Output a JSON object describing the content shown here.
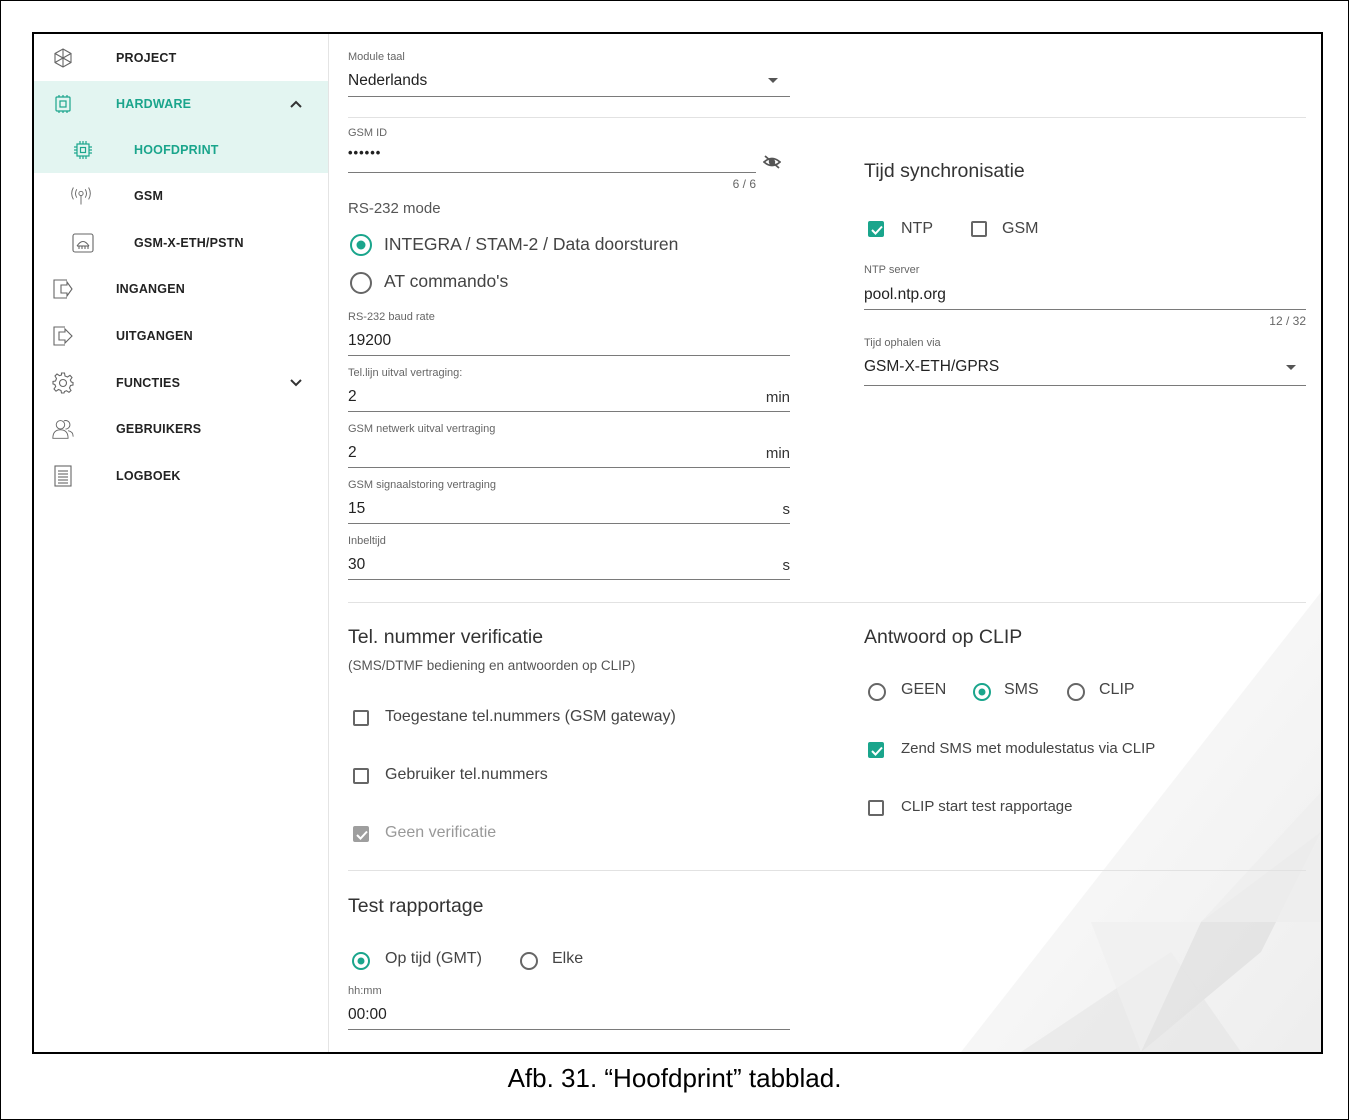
{
  "sidebar": {
    "items": [
      {
        "label": "PROJECT",
        "icon": "snowflake-icon"
      },
      {
        "label": "HARDWARE",
        "icon": "chip-icon"
      },
      {
        "label": "HOOFDPRINT",
        "icon": "processor-icon"
      },
      {
        "label": "GSM",
        "icon": "antenna-icon"
      },
      {
        "label": "GSM-X-ETH/PSTN",
        "icon": "module-icon"
      },
      {
        "label": "INGANGEN",
        "icon": "input-icon"
      },
      {
        "label": "UITGANGEN",
        "icon": "output-icon"
      },
      {
        "label": "FUNCTIES",
        "icon": "gear-icon"
      },
      {
        "label": "GEBRUIKERS",
        "icon": "users-icon"
      },
      {
        "label": "LOGBOEK",
        "icon": "document-icon"
      }
    ]
  },
  "form": {
    "module_taal": {
      "label": "Module taal",
      "value": "Nederlands"
    },
    "gsm_id": {
      "label": "GSM ID",
      "value": "••••••",
      "counter": "6 / 6"
    },
    "rs232_mode": {
      "label": "RS-232 mode",
      "options": [
        "INTEGRA / STAM-2 / Data doorsturen",
        "AT commando's"
      ],
      "selected": 0
    },
    "baud_rate": {
      "label": "RS-232 baud rate",
      "value": "19200"
    },
    "tel_delay": {
      "label": "Tel.lijn uitval vertraging:",
      "value": "2",
      "unit": "min"
    },
    "gsm_net_delay": {
      "label": "GSM netwerk uitval vertraging",
      "value": "2",
      "unit": "min"
    },
    "gsm_signal_delay": {
      "label": "GSM signaalstoring vertraging",
      "value": "15",
      "unit": "s"
    },
    "inbeltijd": {
      "label": "Inbeltijd",
      "value": "30",
      "unit": "s"
    }
  },
  "time_sync": {
    "title": "Tijd synchronisatie",
    "ntp_label": "NTP",
    "ntp_checked": true,
    "gsm_label": "GSM",
    "gsm_checked": false,
    "server": {
      "label": "NTP server",
      "value": "pool.ntp.org",
      "counter": "12 / 32"
    },
    "via": {
      "label": "Tijd ophalen via",
      "value": "GSM-X-ETH/GPRS"
    }
  },
  "verification": {
    "title": "Tel. nummer verificatie",
    "subtitle": "(SMS/DTMF bediening en antwoorden op CLIP)",
    "options": [
      {
        "label": "Toegestane tel.nummers (GSM gateway)",
        "checked": false
      },
      {
        "label": "Gebruiker tel.nummers",
        "checked": false
      },
      {
        "label": "Geen verificatie",
        "checked": true,
        "disabled": true
      }
    ]
  },
  "clip": {
    "title": "Antwoord op CLIP",
    "radios": [
      "GEEN",
      "SMS",
      "CLIP"
    ],
    "selected": 1,
    "options": [
      {
        "label": "Zend SMS met modulestatus via CLIP",
        "checked": true
      },
      {
        "label": "CLIP start test rapportage",
        "checked": false
      }
    ]
  },
  "test": {
    "title": "Test rapportage",
    "radios": [
      "Op tijd (GMT)",
      "Elke"
    ],
    "selected": 0,
    "time": {
      "label": "hh:mm",
      "value": "00:00"
    }
  },
  "caption": "Afb. 31. “Hoofdprint” tabblad.",
  "colors": {
    "accent": "#1aa58c",
    "active_bg": "#e3f5f1"
  }
}
